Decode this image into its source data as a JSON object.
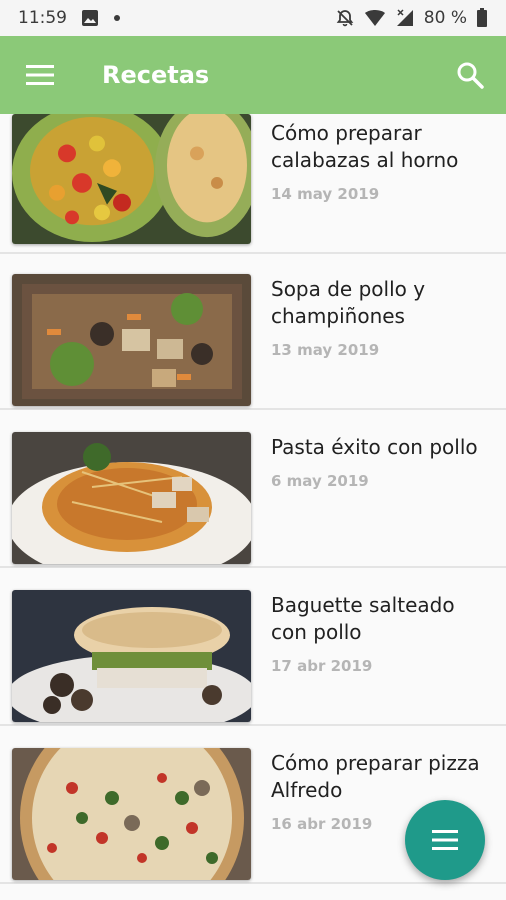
{
  "status_bar": {
    "time": "11:59",
    "battery": "80 %",
    "icons": [
      "gallery-icon",
      "notification-dot-icon",
      "notifications-off-icon",
      "wifi-icon",
      "signal-icon",
      "battery-icon"
    ]
  },
  "app_bar": {
    "title": "Recetas",
    "color": "#8bc978",
    "menu_icon": "hamburger-menu-icon",
    "search_icon": "search-icon"
  },
  "recipes": [
    {
      "title": "Cómo preparar calabazas al horno",
      "date": "14 may 2019"
    },
    {
      "title": "Sopa de pollo y champiñones",
      "date": "13 may 2019"
    },
    {
      "title": "Pasta éxito con pollo",
      "date": "6 may 2019"
    },
    {
      "title": "Baguette salteado con pollo",
      "date": "17 abr 2019"
    },
    {
      "title": "Cómo preparar pizza Alfredo",
      "date": "16 abr 2019"
    }
  ],
  "fab": {
    "icon": "list-menu-icon",
    "color": "#1f9a8a"
  }
}
